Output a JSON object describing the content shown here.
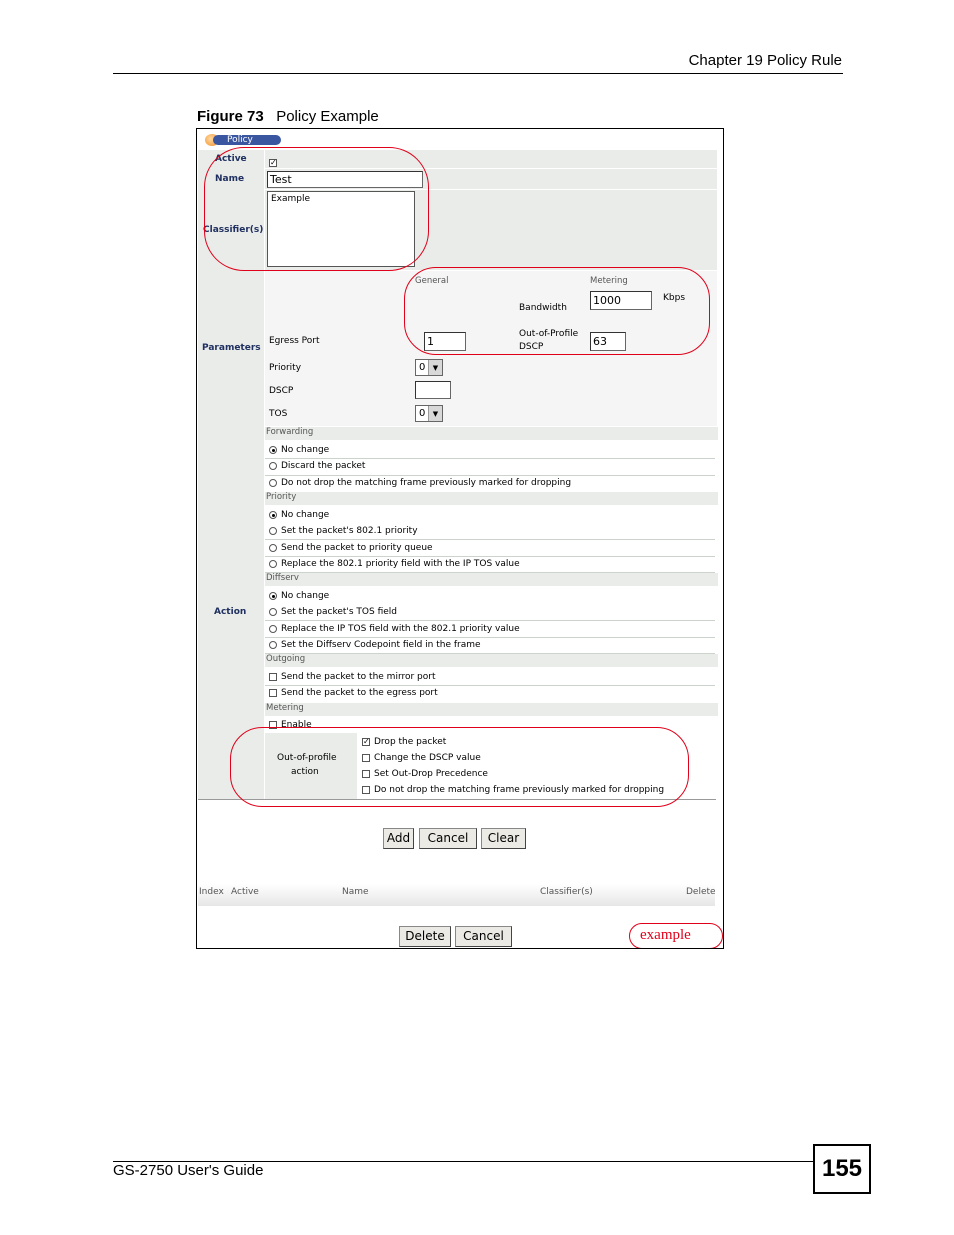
{
  "header": {
    "chapter": "Chapter 19 Policy Rule"
  },
  "figure": {
    "number": "Figure 73",
    "title": "Policy Example"
  },
  "panel": {
    "title": "Policy",
    "active_label": "Active",
    "active_checked": true,
    "name_label": "Name",
    "name_value": "Test",
    "classifier_label": "Classifier(s)",
    "classifier_item": "Example",
    "parameters_label": "Parameters",
    "general_label": "General",
    "metering_label": "Metering",
    "bandwidth_label": "Bandwidth",
    "bandwidth_value": "1000",
    "bandwidth_unit": "Kbps",
    "egress_port_label": "Egress Port",
    "egress_port_value": "1",
    "oop_dscp_label_1": "Out-of-Profile",
    "oop_dscp_label_2": "DSCP",
    "oop_dscp_value": "63",
    "priority_label": "Priority",
    "priority_value": "0",
    "dscp_label": "DSCP",
    "dscp_value": "",
    "tos_label": "TOS",
    "tos_value": "0",
    "action_label": "Action",
    "forwarding_label": "Forwarding",
    "forwarding_options": [
      "No change",
      "Discard the packet",
      "Do not drop the matching frame previously marked for dropping"
    ],
    "priority_section_label": "Priority",
    "priority_options": [
      "No change",
      "Set the packet's 802.1 priority",
      "Send the packet to priority queue",
      "Replace the 802.1 priority field with the IP TOS value"
    ],
    "diffserv_label": "Diffserv",
    "diffserv_options": [
      "No change",
      "Set the packet's TOS field",
      "Replace the IP TOS field with the 802.1 priority value",
      "Set the Diffserv Codepoint field in the frame"
    ],
    "outgoing_label": "Outgoing",
    "outgoing_options": [
      "Send the packet to the mirror port",
      "Send the packet to the egress port"
    ],
    "metering_section_label": "Metering",
    "enable_label": "Enable",
    "oop_action_label_1": "Out-of-profile",
    "oop_action_label_2": "action",
    "oop_action_options": [
      "Drop the packet",
      "Change the DSCP value",
      "Set Out-Drop Precedence",
      "Do not drop the matching frame previously marked for dropping"
    ],
    "add_button": "Add",
    "cancel_button": "Cancel",
    "clear_button": "Clear",
    "table_headers": [
      "Index",
      "Active",
      "Name",
      "Classifier(s)",
      "Delete"
    ],
    "delete_button": "Delete",
    "cancel_button_2": "Cancel",
    "example_tag": "example"
  },
  "footer": {
    "guide": "GS-2750 User's Guide",
    "page_number": "155"
  },
  "colors": {
    "annotation": "#e0001a",
    "label_text": "#203060",
    "cell_bg": "#e9ece9"
  }
}
